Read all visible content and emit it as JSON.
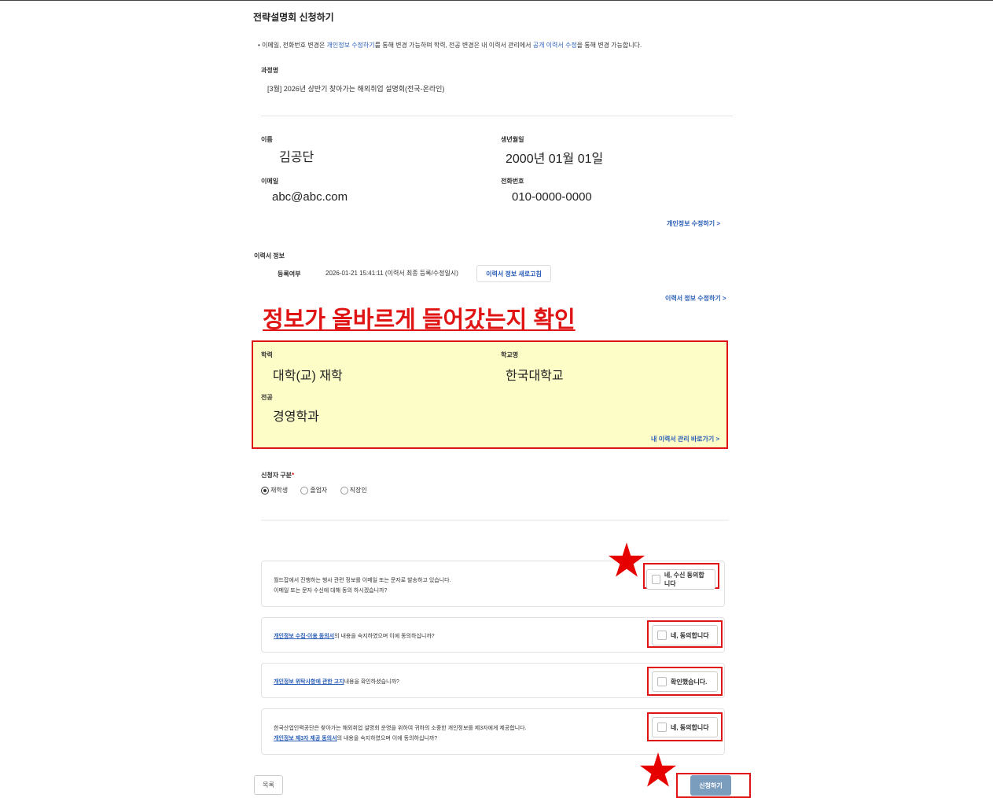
{
  "page": {
    "title": "전략설명회 신청하기",
    "notice": {
      "part1": "이메일, 전화번호 변경은 ",
      "link1": "개인정보 수정하기",
      "part2": "를 통해 변경 가능하며 학력, 전공 변경은 내 이력서 관리에서 ",
      "link2": "공개 이력서 수정",
      "part3": "을 통해 변경 가능합니다."
    },
    "course": {
      "label": "과정명",
      "value": "[3월] 2026년 상반기 찾아가는 해외취업 설명회(전국-온라인)"
    }
  },
  "personal": {
    "name_label": "이름",
    "name": "김공단",
    "birth_label": "생년월일",
    "birth": "2000년 01월 01일",
    "email_label": "이메일",
    "email": "abc@abc.com",
    "phone_label": "전화번호",
    "phone": "010-0000-0000",
    "edit_link": "개인정보 수정하기 >"
  },
  "resume": {
    "section_label": "이력서 정보",
    "status_label": "등록여부",
    "status_value": "2026-01-21 15:41:11 (이력서 최종 등록/수정일시)",
    "refresh_button": "이력서 정보 새로고침",
    "edit_link": "이력서 정보 수정하기 >"
  },
  "annotation": {
    "heading": "정보가 올바르게 들어갔는지 확인"
  },
  "education": {
    "degree_label": "학력",
    "degree": "대학(교) 재학",
    "school_label": "학교명",
    "school": "한국대학교",
    "major_label": "전공",
    "major": "경영학과",
    "manage_link": "내 이력서 관리 바로가기 >"
  },
  "applicant_type": {
    "label": "신청자 구분",
    "required_mark": "*",
    "options": [
      "재학생",
      "졸업자",
      "직장인"
    ],
    "selected": "재학생"
  },
  "agreements": [
    {
      "line1": "월드잡에서 진행하는 행사 관련 정보를 이메일 또는 문자로 발송하고 있습니다.",
      "line2": "이메일 또는 문자 수신에 대해 동의 하시겠습니까?",
      "button": "네, 수신 동의합니다"
    },
    {
      "link": "개인정보 수집·이용 동의서",
      "text": "의 내용을 숙지하였으며 이에 동의하십니까?",
      "button": "네, 동의합니다"
    },
    {
      "link": "개인정보 위탁사항에 관한 고지",
      "text": "내용을 확인하셨습니까?",
      "button": "확인했습니다."
    },
    {
      "line1": "한국산업인력공단은 찾아가는 해외취업 설명회 운영을 위하여 귀하의 소중한 개인정보를 제3자에게 제공합니다.",
      "link": "개인정보 제3자 제공 동의서",
      "text": "의 내용을 숙지하였으며 이에 동의하십니까?",
      "button": "네, 동의합니다"
    }
  ],
  "footer": {
    "list_button": "목록",
    "submit_button": "신청하기"
  },
  "colors": {
    "accent_link": "#2b5fb8",
    "annotation_red": "#e01414",
    "highlight_yellow": "#fdfdc8",
    "submit_bg": "#7a9cbd"
  }
}
